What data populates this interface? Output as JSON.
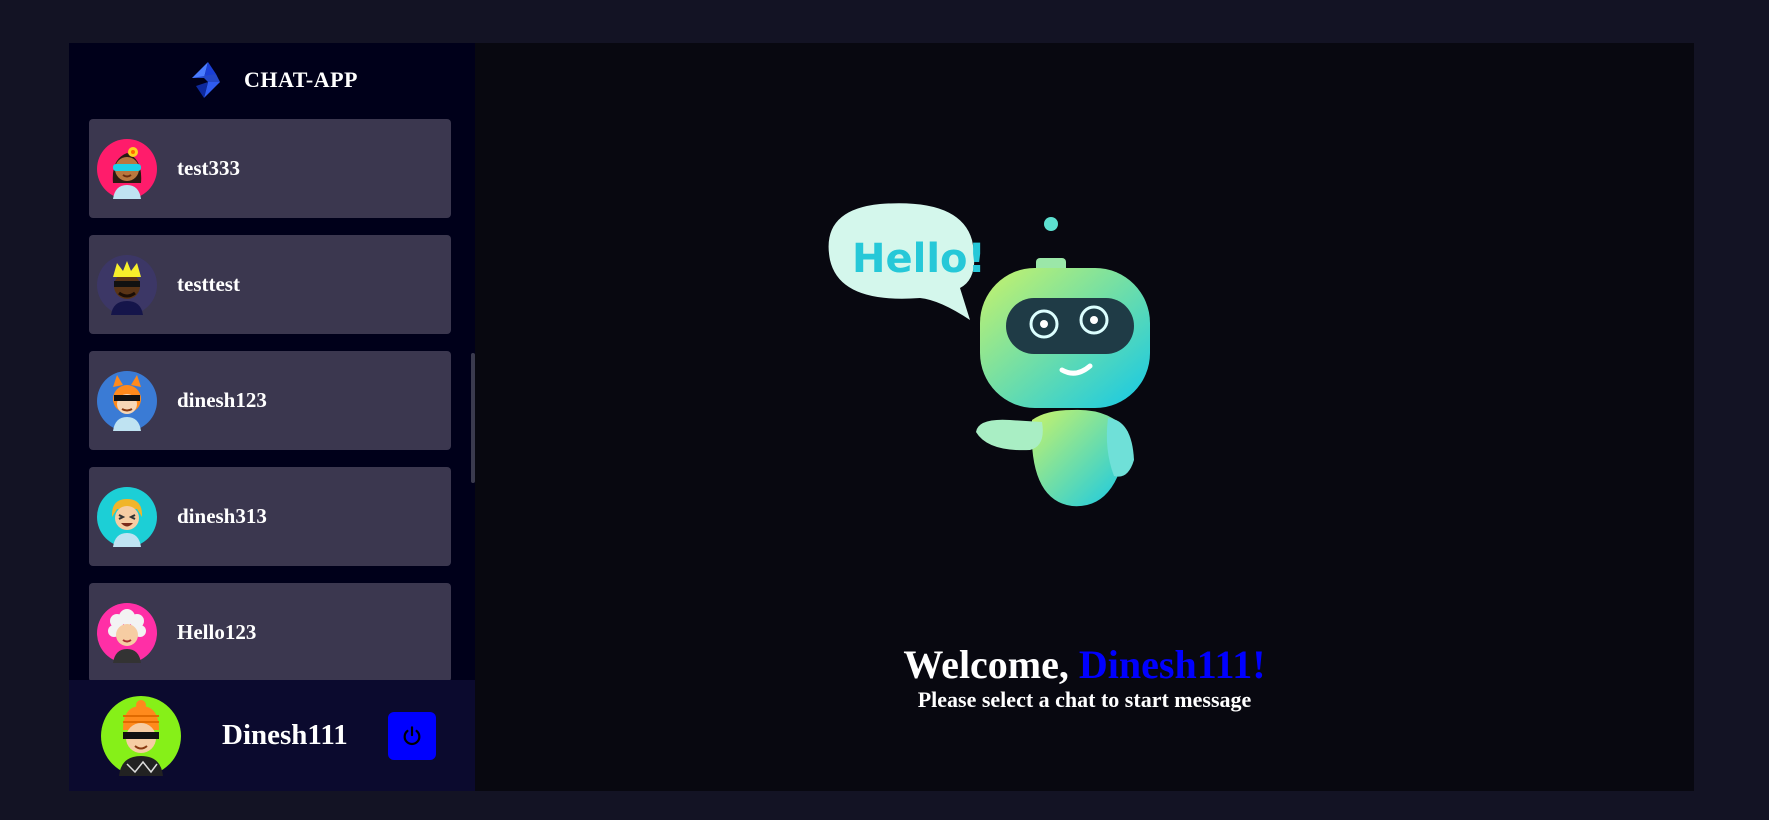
{
  "app": {
    "title": "CHAT-APP"
  },
  "contacts": [
    {
      "name": "test333",
      "avatar": "avatar-woman-visor-icon"
    },
    {
      "name": "testtest",
      "avatar": "avatar-man-sunglasses-icon"
    },
    {
      "name": "dinesh123",
      "avatar": "avatar-fox-sunglasses-icon"
    },
    {
      "name": "dinesh313",
      "avatar": "avatar-blonde-laughing-icon"
    },
    {
      "name": "Hello123",
      "avatar": "avatar-curly-hair-icon"
    }
  ],
  "current_user": {
    "name": "Dinesh111",
    "avatar": "avatar-orange-beanie-sunglasses-icon"
  },
  "logout": {
    "icon": "power-icon"
  },
  "welcome": {
    "greeting": "Welcome, ",
    "username": "Dinesh111!",
    "subtitle": "Please select a chat to start message",
    "illustration_text": "Hello!"
  },
  "colors": {
    "background": "#131324",
    "sidebar": "#00001a",
    "contact_card": "#3b374f",
    "user_bar": "#0b0a2e",
    "accent": "#0000ff"
  }
}
